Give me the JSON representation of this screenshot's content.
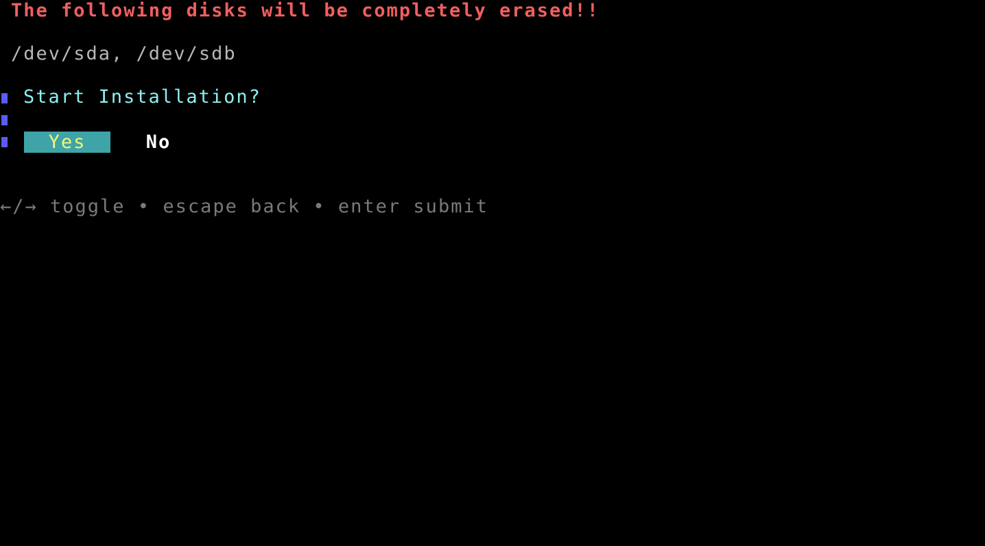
{
  "warning": "The following disks will be completely erased!!",
  "disks": "/dev/sda, /dev/sdb",
  "prompt": {
    "title": "Start Installation?",
    "options": [
      {
        "label": "Yes",
        "selected": true
      },
      {
        "label": "No",
        "selected": false
      }
    ]
  },
  "help": "←/→ toggle • escape back • enter submit",
  "colors": {
    "warning": "#ef5f5f",
    "prompt": "#8ef0f0",
    "selected_bg": "#3fa4a8",
    "selected_fg": "#f4f47a",
    "border": "#5a5cf2",
    "help": "#7a7a7a"
  }
}
